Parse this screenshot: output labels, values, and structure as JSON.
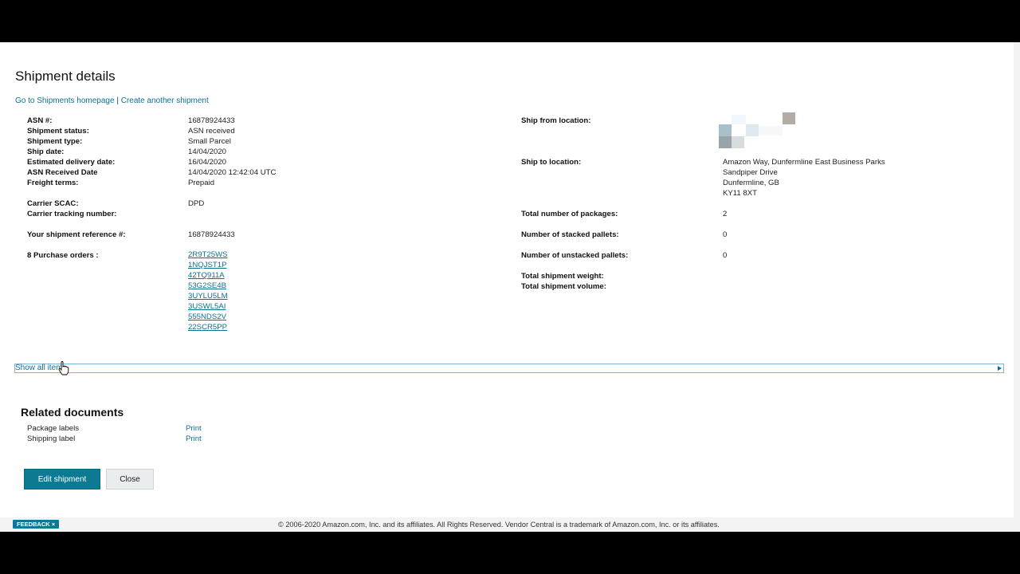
{
  "page": {
    "title": "Shipment details"
  },
  "nav": {
    "home_link": "Go to Shipments homepage",
    "separator": "|",
    "create_link": "Create another shipment"
  },
  "left_fields": [
    {
      "label": "ASN #:",
      "value": "16878924433"
    },
    {
      "label": "Shipment status:",
      "value": "ASN received"
    },
    {
      "label": "Shipment type:",
      "value": "Small Parcel"
    },
    {
      "label": "Ship date:",
      "value": "14/04/2020"
    },
    {
      "label": "Estimated delivery date:",
      "value": "16/04/2020"
    },
    {
      "label": "ASN Received Date",
      "value": "14/04/2020 12:42:04 UTC"
    },
    {
      "label": "Freight terms:",
      "value": "Prepaid"
    },
    {
      "label": "Carrier SCAC:",
      "value": "DPD"
    },
    {
      "label": "Carrier tracking number:",
      "value": ""
    },
    {
      "label": "Your shipment reference #:",
      "value": "16878924433"
    }
  ],
  "purchase_orders": {
    "label": "8 Purchase orders :",
    "items": [
      "2R9T25WS",
      "1NQJST1P",
      "42TQ911A",
      "53G2SE4B",
      "3UYLU5LM",
      "3USWL5AI",
      "555NDS2V",
      "22SCR5PP"
    ]
  },
  "right_fields": {
    "ship_from_label": "Ship from location:",
    "ship_to_label": "Ship to location:",
    "ship_to_address": [
      "Amazon Way, Dunfermline East Business Parks",
      "Sandpiper Drive",
      "Dunfermline, GB",
      "KY11 8XT"
    ],
    "packages_label": "Total number of packages:",
    "packages_value": "2",
    "stacked_label": "Number of stacked pallets:",
    "stacked_value": "0",
    "unstacked_label": "Number of unstacked pallets:",
    "unstacked_value": "0",
    "weight_label": "Total shipment weight:",
    "volume_label": "Total shipment volume:"
  },
  "items_section": {
    "show_all_label": "Show all items"
  },
  "related_documents": {
    "title": "Related documents",
    "docs": [
      {
        "label": "Package labels",
        "action": "Print"
      },
      {
        "label": "Shipping label",
        "action": "Print"
      }
    ]
  },
  "actions": {
    "edit_label": "Edit shipment",
    "close_label": "Close"
  },
  "footer": {
    "copyright": "© 2006-2020 Amazon.com, Inc. and its affiliates. All Rights Reserved. Vendor Central is a trademark of Amazon.com, Inc. or its affiliates.",
    "feedback_label": "FEEDBACK",
    "feedback_close": "×"
  },
  "colors": {
    "link": "#0f6f8e",
    "primary_button": "#0b7a92"
  },
  "icons": {
    "expand": "triangle-right-icon",
    "cursor": "hand-cursor-icon",
    "redacted": "pixelated-image"
  }
}
